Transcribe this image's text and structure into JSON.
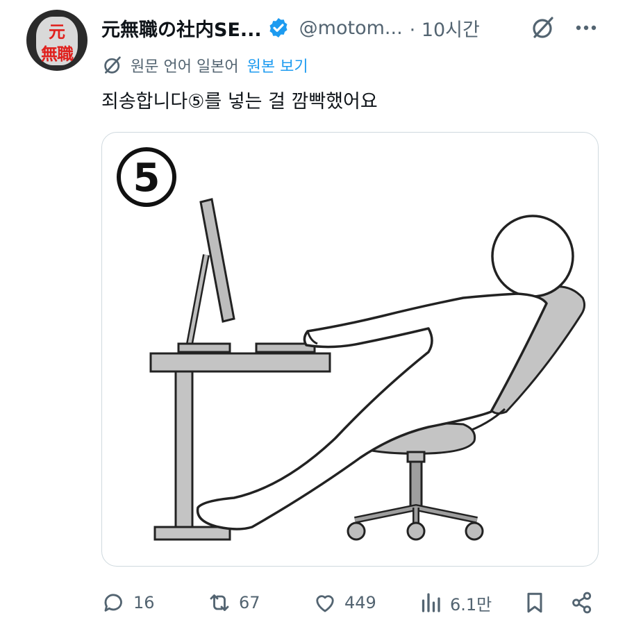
{
  "author": {
    "avatar_text_top": "元",
    "avatar_text_bottom": "無職",
    "display_name": "元無職の社内SE...",
    "handle": "@motom...",
    "time": "· 10시간"
  },
  "translation": {
    "note": "원문 언어 일본어",
    "show_original": "원본 보기"
  },
  "tweet": {
    "text": "죄송합니다⑤를 넣는 걸 깜빡했어요",
    "media": {
      "step_number": "5"
    }
  },
  "actions": {
    "replies": "16",
    "reposts": "67",
    "likes": "449",
    "views": "6.1만"
  },
  "colors": {
    "accent": "#1d9bf0",
    "muted": "#536471",
    "border": "#cfd9de"
  }
}
